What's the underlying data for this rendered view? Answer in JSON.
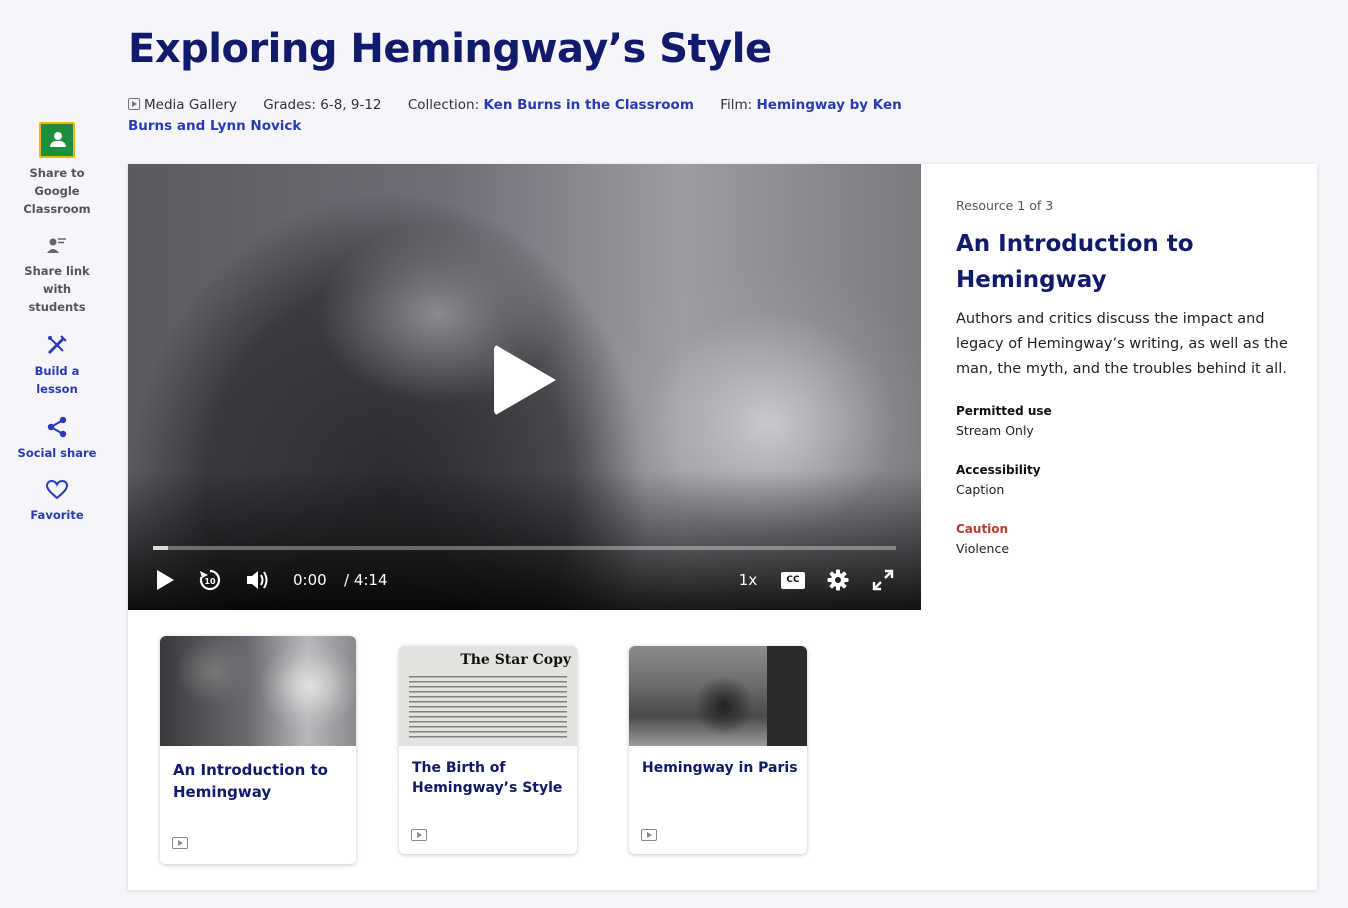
{
  "page": {
    "title": "Exploring Hemingway’s Style"
  },
  "meta": {
    "type": "Media Gallery",
    "grades_label": "Grades: 6-8, 9-12",
    "collection_label": "Collection:",
    "collection_value": "Ken Burns in the Classroom",
    "film_label": "Film:",
    "film_value": "Hemingway by Ken Burns and Lynn Novick"
  },
  "sidebar": {
    "items": [
      {
        "label": "Share to Google Classroom",
        "icon": "google-classroom-icon"
      },
      {
        "label": "Share link with students",
        "icon": "share-link-icon"
      },
      {
        "label": "Build a lesson",
        "icon": "build-lesson-icon"
      },
      {
        "label": "Social share",
        "icon": "share-icon"
      },
      {
        "label": "Favorite",
        "icon": "heart-icon"
      }
    ]
  },
  "player": {
    "current_time": "0:00",
    "duration": "/ 4:14",
    "progress": 0.02,
    "speed": "1x",
    "cc": "CC"
  },
  "resource": {
    "count": "Resource 1 of 3",
    "title": "An Introduction to Hemingway",
    "description": "Authors and critics discuss the impact and legacy of Hemingway’s writing, as well as the man, the myth, and the troubles behind it all.",
    "permitted_use_label": "Permitted use",
    "permitted_use_value": "Stream Only",
    "accessibility_label": "Accessibility",
    "accessibility_value": "Caption",
    "caution_label": "Caution",
    "caution_value": "Violence"
  },
  "thumbnails": [
    {
      "title": "An Introduction to Hemingway",
      "selected": true
    },
    {
      "title": "The Birth of Hemingway’s Style",
      "image_text": "The Star Copy"
    },
    {
      "title": "Hemingway in Paris"
    }
  ],
  "colors": {
    "title": "#111a6b",
    "link": "#2b3bb8",
    "caution": "#c0392b",
    "background": "#f5f5fa"
  }
}
